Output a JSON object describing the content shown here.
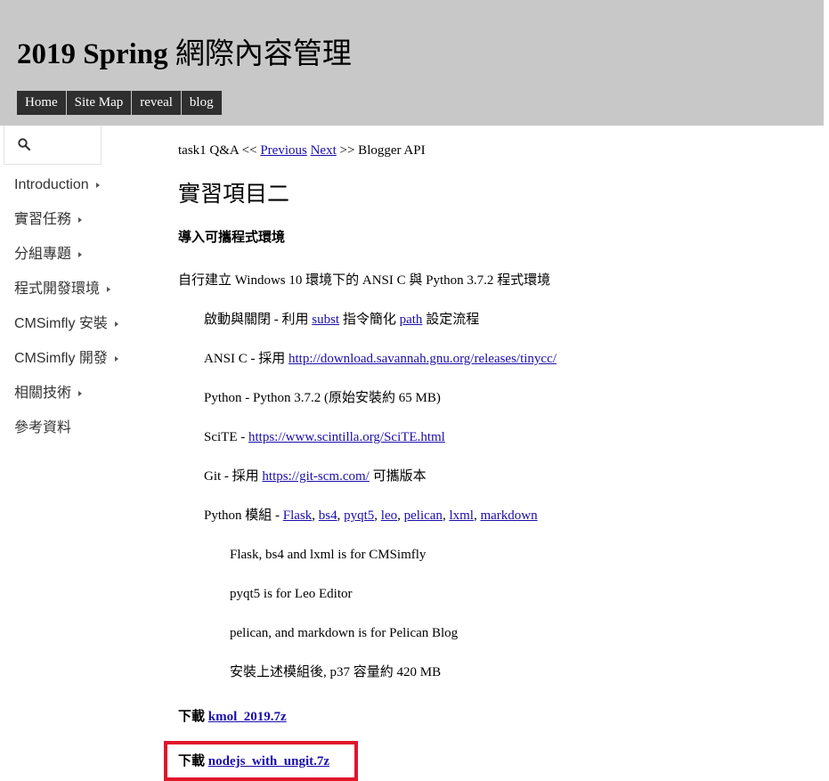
{
  "header": {
    "title_latin": "2019 Spring",
    "title_cjk": "網際內容管理",
    "menu": [
      "Home",
      "Site Map",
      "reveal",
      "blog"
    ]
  },
  "sidebar": {
    "items": [
      {
        "label": "Introduction",
        "has_submenu": true
      },
      {
        "label": "實習任務",
        "has_submenu": true
      },
      {
        "label": "分組專題",
        "has_submenu": true
      },
      {
        "label": "程式開發環境",
        "has_submenu": true
      },
      {
        "label": "CMSimfly 安裝",
        "has_submenu": true
      },
      {
        "label": "CMSimfly 開發",
        "has_submenu": true
      },
      {
        "label": "相關技術",
        "has_submenu": true
      },
      {
        "label": "參考資料",
        "has_submenu": false
      }
    ]
  },
  "nav": {
    "prefix": "task1 Q&A <<",
    "previous": "Previous",
    "next": "Next",
    "suffix": ">> Blogger API"
  },
  "content": {
    "heading": "實習項目二",
    "section_heading": "導入可攜程式環境",
    "intro": "自行建立 Windows 10 環境下的 ANSI C 與 Python 3.7.2 程式環境",
    "startup": {
      "prefix": "啟動與關閉  - 利用 ",
      "link1": "subst",
      "middle": " 指令簡化 ",
      "link2": "path",
      "suffix": " 設定流程"
    },
    "ansi_c": {
      "prefix": "ANSI C - 採用 ",
      "link": "http://download.savannah.gnu.org/releases/tinycc/"
    },
    "python": "Python - Python 3.7.2 (原始安裝約 65 MB)",
    "scite": {
      "prefix": "SciTE - ",
      "link": "https://www.scintilla.org/SciTE.html"
    },
    "git": {
      "prefix": "Git - 採用 ",
      "link": "https://git-scm.com/",
      "suffix": " 可攜版本"
    },
    "modules": {
      "prefix": "Python 模組 - ",
      "links": [
        "Flask",
        "bs4",
        "pyqt5",
        "leo",
        "pelican",
        "lxml",
        "markdown"
      ]
    },
    "notes": [
      "Flask, bs4 and lxml is for CMSimfly",
      "pyqt5 is for Leo Editor",
      "pelican, and markdown is for Pelican Blog",
      "安裝上述模組後, p37 容量約 420 MB"
    ],
    "downloads": [
      {
        "prefix": "下載 ",
        "link": "kmol_2019.7z"
      },
      {
        "prefix": "下載 ",
        "link": "nodejs_with_ungit.7z"
      }
    ]
  },
  "colors": {
    "header_bg": "#c8c8c8",
    "menu_bg": "#2f2f2f",
    "link": "#1a0dab",
    "highlight": "#e0162b"
  }
}
